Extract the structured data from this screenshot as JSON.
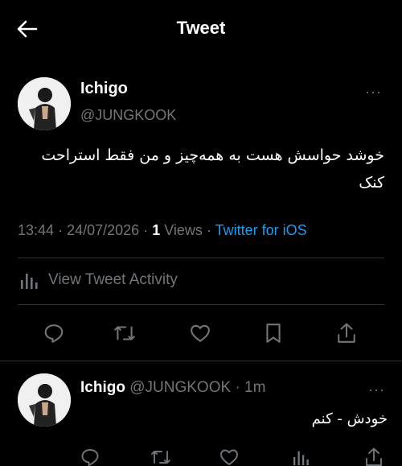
{
  "header": {
    "title": "Tweet",
    "back_icon": "arrow-left-icon"
  },
  "tweet": {
    "author_name": "Ichigo",
    "author_handle": "@JUNGKOOK",
    "more": "···",
    "text": "خوشد حواسش هست به همه‌چیز و من فقط استراحت کنک",
    "time": "13:44",
    "date": "24/07/2026",
    "separator": "·",
    "views_count": "1",
    "views_label": "Views",
    "source": "Twitter for iOS",
    "activity_label": "View Tweet Activity"
  },
  "actions": [
    "reply-icon",
    "retweet-icon",
    "like-icon",
    "bookmark-icon",
    "share-icon"
  ],
  "reply": {
    "author_name": "Ichigo",
    "author_handle": "@JUNGKOOK",
    "age": "1m",
    "more": "···",
    "text": "خودش - کنم"
  },
  "colors": {
    "background": "#000000",
    "text": "#e7e9ea",
    "muted": "#71767b",
    "link": "#1d9bf0",
    "divider": "#2f3336"
  }
}
